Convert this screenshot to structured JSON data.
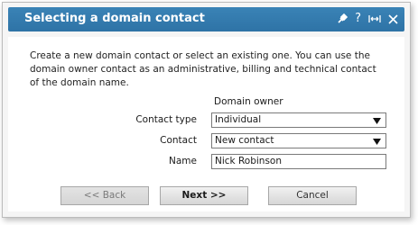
{
  "dialog": {
    "title": "Selecting a domain contact",
    "description": "Create a new domain contact or select an existing one. You can use the domain owner contact as an administrative, billing and technical contact of the domain name.",
    "column_header": "Domain owner",
    "fields": {
      "contact_type": {
        "label": "Contact type",
        "value": "Individual"
      },
      "contact": {
        "label": "Contact",
        "value": "New contact"
      },
      "name": {
        "label": "Name",
        "value": "Nick Robinson"
      }
    },
    "buttons": {
      "back": "<< Back",
      "next": "Next >>",
      "cancel": "Cancel"
    },
    "help_glyph": "?"
  },
  "colors": {
    "titlebar": "#2e73a6",
    "button_face": "#e0e0e0"
  }
}
